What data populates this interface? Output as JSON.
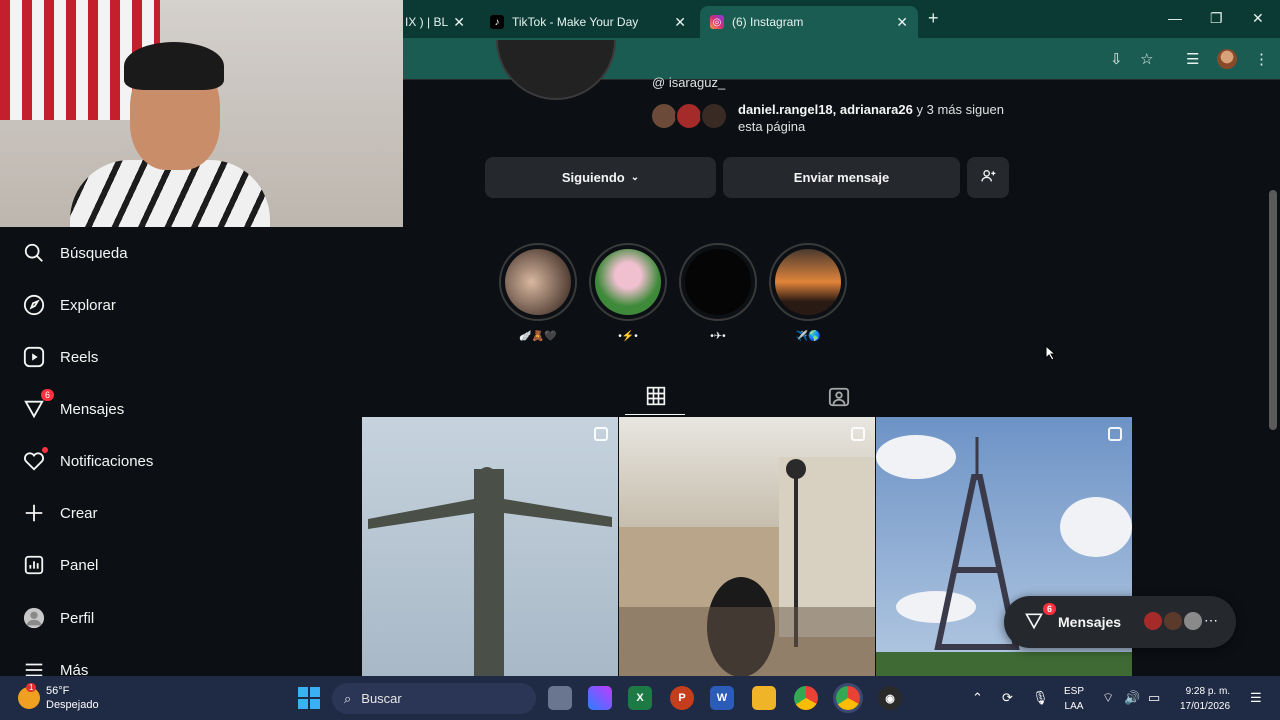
{
  "browser": {
    "tabs": [
      {
        "title": "IX ) | BL",
        "icon": "music-icon"
      },
      {
        "title": "TikTok - Make Your Day",
        "icon": "tiktok-icon"
      },
      {
        "title": "(6) Instagram",
        "icon": "instagram-icon"
      }
    ],
    "new_tab": "+",
    "window_controls": {
      "minimize": "—",
      "restore": "❐",
      "close": "✕"
    }
  },
  "sidebar": {
    "items": [
      {
        "label": "Búsqueda",
        "icon": "search-icon"
      },
      {
        "label": "Explorar",
        "icon": "compass-icon"
      },
      {
        "label": "Reels",
        "icon": "reels-icon"
      },
      {
        "label": "Mensajes",
        "icon": "messenger-icon",
        "badge": "6"
      },
      {
        "label": "Notificaciones",
        "icon": "heart-icon"
      },
      {
        "label": "Crear",
        "icon": "plus-icon"
      },
      {
        "label": "Panel",
        "icon": "chart-icon"
      },
      {
        "label": "Perfil",
        "icon": "profile-icon"
      },
      {
        "label": "Más",
        "icon": "menu-icon"
      }
    ]
  },
  "profile": {
    "username": "isaraguz_",
    "followed_by_names": "daniel.rangel18, adrianara26",
    "followed_by_rest": " y 3 más siguen esta página",
    "buttons": {
      "following": "Siguiendo",
      "message": "Enviar mensaje"
    }
  },
  "highlights": [
    {
      "label": "🪽🧸🖤"
    },
    {
      "label": "•⚡•"
    },
    {
      "label": "•✈•"
    },
    {
      "label": "✈️🌎"
    }
  ],
  "messages_pill": {
    "label": "Mensajes",
    "badge": "6"
  },
  "taskbar": {
    "weather": {
      "temp": "56°F",
      "desc": "Despejado",
      "badge": "1"
    },
    "search_placeholder": "Buscar",
    "lang_top": "ESP",
    "lang_bottom": "LAA",
    "time": "9:28 p. m.",
    "date": "17/01/2026"
  }
}
